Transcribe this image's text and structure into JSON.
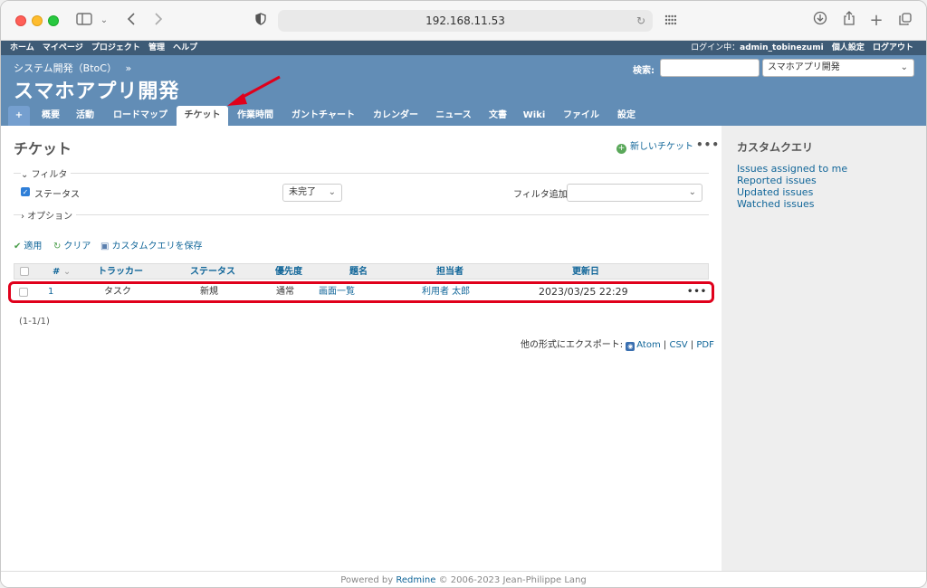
{
  "browser": {
    "url": "192.168.11.53"
  },
  "topmenu": {
    "items": [
      "ホーム",
      "マイページ",
      "プロジェクト",
      "管理",
      "ヘルプ"
    ],
    "login_prefix": "ログイン中：",
    "user": "admin_tobinezumi",
    "my_account": "個人設定",
    "logout": "ログアウト"
  },
  "header": {
    "parent": "システム開発（BtoC）",
    "parent_sep": "»",
    "title": "スマホアプリ開発",
    "search_label": "検索:",
    "project_select": "スマホアプリ開発"
  },
  "tabs": [
    "概要",
    "活動",
    "ロードマップ",
    "チケット",
    "作業時間",
    "ガントチャート",
    "カレンダー",
    "ニュース",
    "文書",
    "Wiki",
    "ファイル",
    "設定"
  ],
  "tab_plus": "+",
  "main": {
    "heading": "チケット",
    "new_issue": "新しいチケット",
    "more": "•••",
    "filter_legend": "フィルタ",
    "status_label": "ステータス",
    "status_operator": "未完了",
    "add_filter_label": "フィルタ追加",
    "options_legend": "オプション",
    "apply": "適用",
    "clear": "クリア",
    "save_query": "カスタムクエリを保存"
  },
  "table": {
    "headers": [
      "#",
      "トラッカー",
      "ステータス",
      "優先度",
      "題名",
      "担当者",
      "更新日"
    ],
    "rows": [
      {
        "id": "1",
        "tracker": "タスク",
        "status": "新規",
        "priority": "通常",
        "subject": "画面一覧",
        "assignee": "利用者 太郎",
        "updated": "2023/03/25 22:29"
      }
    ],
    "count": "(1-1/1)",
    "export_label": "他の形式にエクスポート:",
    "export_atom": "Atom",
    "export_csv": "CSV",
    "export_pdf": "PDF",
    "export_sep": "|"
  },
  "sidebar": {
    "title": "カスタムクエリ",
    "queries": [
      "Issues assigned to me",
      "Reported issues",
      "Updated issues",
      "Watched issues"
    ]
  },
  "footer": {
    "powered_by": "Powered by",
    "redmine": "Redmine",
    "copyright": "© 2006-2023 Jean-Philippe Lang"
  },
  "colors": {
    "header_bg": "#628db6",
    "topmenu_bg": "#3e5b76",
    "link": "#116699",
    "highlight": "#e0001b"
  }
}
